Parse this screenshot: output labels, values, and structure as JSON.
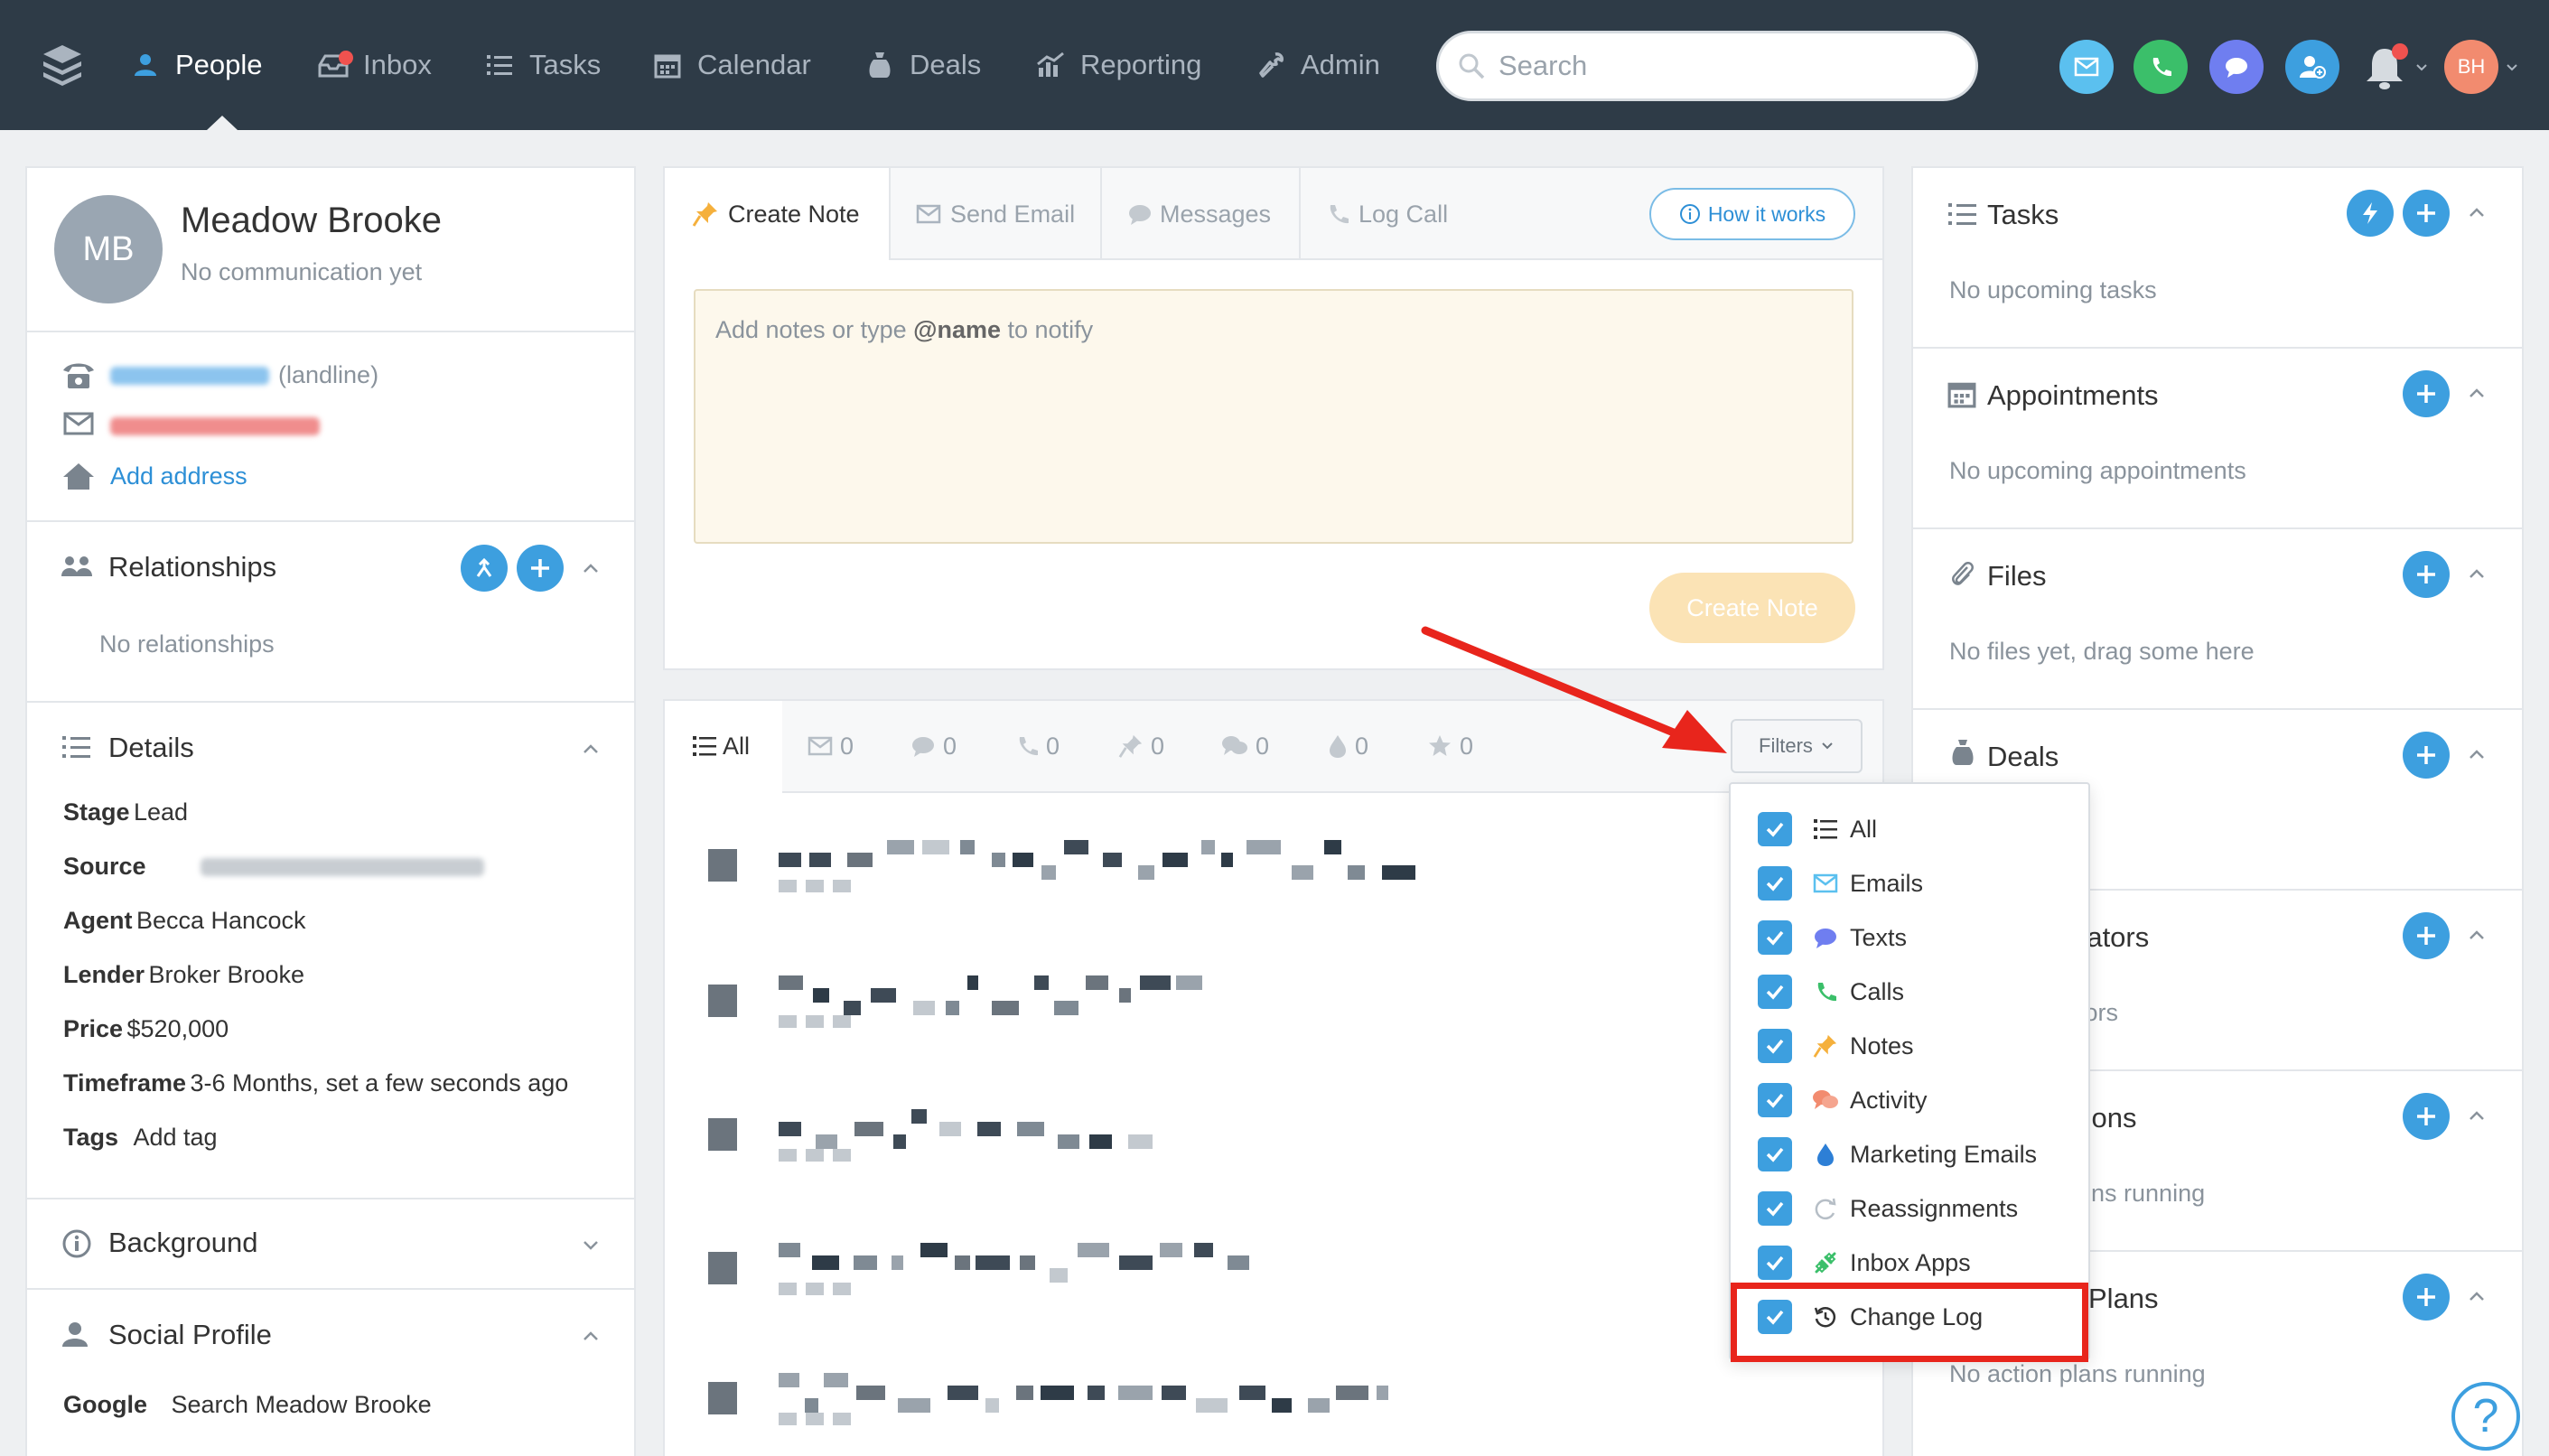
{
  "nav": {
    "items": [
      {
        "label": "People",
        "icon": "person-icon",
        "active": true
      },
      {
        "label": "Inbox",
        "icon": "inbox-icon"
      },
      {
        "label": "Tasks",
        "icon": "list-icon"
      },
      {
        "label": "Calendar",
        "icon": "calendar-icon"
      },
      {
        "label": "Deals",
        "icon": "moneybag-icon"
      },
      {
        "label": "Reporting",
        "icon": "chart-icon"
      },
      {
        "label": "Admin",
        "icon": "wrench-icon"
      }
    ],
    "search_placeholder": "Search",
    "user_initials": "BH"
  },
  "contact": {
    "initials": "MB",
    "name": "Meadow Brooke",
    "comm_status": "No communication yet",
    "phone_type": "(landline)",
    "add_address": "Add address"
  },
  "relationships": {
    "title": "Relationships",
    "empty": "No relationships"
  },
  "details": {
    "title": "Details",
    "rows": [
      {
        "label": "Stage",
        "value": "Lead"
      },
      {
        "label": "Source",
        "value": ""
      },
      {
        "label": "Agent",
        "value": "Becca Hancock"
      },
      {
        "label": "Lender",
        "value": "Broker Brooke"
      },
      {
        "label": "Price",
        "value": "$520,000"
      },
      {
        "label": "Timeframe",
        "value": "3-6 Months, set a few seconds ago"
      }
    ],
    "tags_label": "Tags",
    "add_tag": "Add tag"
  },
  "background": {
    "title": "Background"
  },
  "social": {
    "title": "Social Profile",
    "google_label": "Google",
    "google_link": "Search Meadow Brooke"
  },
  "composer": {
    "tabs": [
      "Create Note",
      "Send Email",
      "Messages",
      "Log Call"
    ],
    "how_it_works": "How it works",
    "placeholder_pre": "Add notes or type ",
    "placeholder_bold": "@name",
    "placeholder_post": " to notify",
    "submit": "Create Note"
  },
  "timeline": {
    "all_label": "All",
    "counts": [
      "0",
      "0",
      "0",
      "0",
      "0",
      "0",
      "0"
    ],
    "filters_label": "Filters"
  },
  "filters_dropdown": {
    "items": [
      {
        "label": "All",
        "checked": true
      },
      {
        "label": "Emails",
        "checked": true
      },
      {
        "label": "Texts",
        "checked": true
      },
      {
        "label": "Calls",
        "checked": true
      },
      {
        "label": "Notes",
        "checked": true
      },
      {
        "label": "Activity",
        "checked": true
      },
      {
        "label": "Marketing Emails",
        "checked": true
      },
      {
        "label": "Reassignments",
        "checked": true
      },
      {
        "label": "Inbox Apps",
        "checked": true
      },
      {
        "label": "Change Log",
        "checked": true
      }
    ]
  },
  "right": {
    "tasks": {
      "title": "Tasks",
      "empty": "No upcoming tasks"
    },
    "appointments": {
      "title": "Appointments",
      "empty": "No upcoming appointments"
    },
    "files": {
      "title": "Files",
      "empty": "No files yet, drag some here"
    },
    "deals": {
      "title": "Deals"
    },
    "collaborators": {
      "title_partial": "rators",
      "empty_partial": "tors"
    },
    "automations": {
      "title_partial": "tions",
      "empty_partial": "ons running"
    },
    "action_plans": {
      "title_partial": "Plans",
      "empty": "No action plans running"
    }
  },
  "help_label": "?",
  "colors": {
    "nav_bg": "#2e3b47",
    "accent_blue": "#3d9fdf",
    "highlight_red": "#e8251c",
    "create_note_disabled": "#fbe3b5"
  }
}
